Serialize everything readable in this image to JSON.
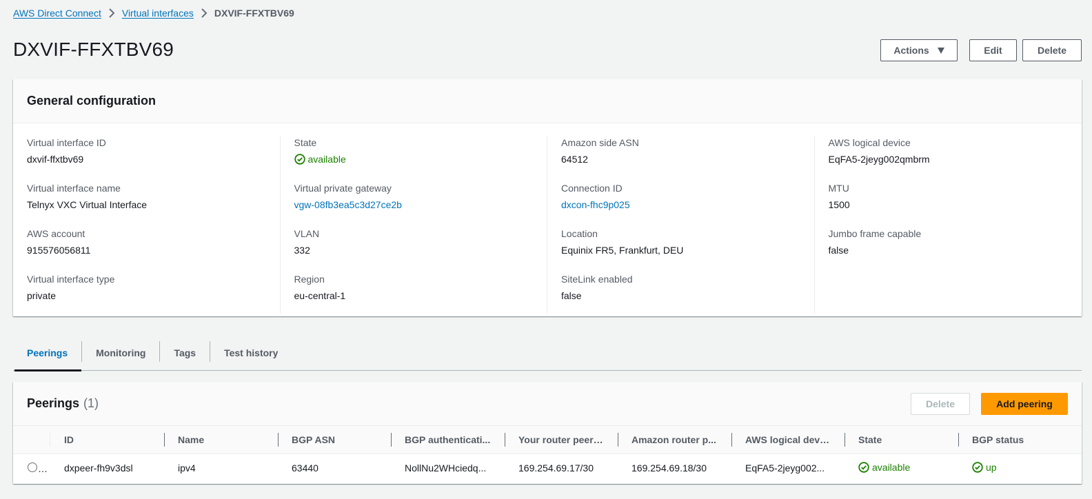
{
  "breadcrumb": {
    "items": [
      {
        "label": "AWS Direct Connect"
      },
      {
        "label": "Virtual interfaces"
      }
    ],
    "current": "DXVIF-FFXTBV69"
  },
  "page": {
    "title": "DXVIF-FFXTBV69"
  },
  "header_actions": {
    "actions_label": "Actions",
    "edit_label": "Edit",
    "delete_label": "Delete"
  },
  "general_configuration": {
    "title": "General configuration",
    "columns": [
      [
        {
          "label": "Virtual interface ID",
          "value": "dxvif-ffxtbv69"
        },
        {
          "label": "Virtual interface name",
          "value": "Telnyx VXC Virtual Interface"
        },
        {
          "label": "AWS account",
          "value": "915576056811"
        },
        {
          "label": "Virtual interface type",
          "value": "private"
        }
      ],
      [
        {
          "label": "State",
          "value": "available"
        },
        {
          "label": "Virtual private gateway",
          "value": "vgw-08fb3ea5c3d27ce2b"
        },
        {
          "label": "VLAN",
          "value": "332"
        },
        {
          "label": "Region",
          "value": "eu-central-1"
        }
      ],
      [
        {
          "label": "Amazon side ASN",
          "value": "64512"
        },
        {
          "label": "Connection ID",
          "value": "dxcon-fhc9p025"
        },
        {
          "label": "Location",
          "value": "Equinix FR5, Frankfurt, DEU"
        },
        {
          "label": "SiteLink enabled",
          "value": "false"
        }
      ],
      [
        {
          "label": "AWS logical device",
          "value": "EqFA5-2jeyg002qmbrm"
        },
        {
          "label": "MTU",
          "value": "1500"
        },
        {
          "label": "Jumbo frame capable",
          "value": "false"
        }
      ]
    ]
  },
  "tabs": [
    {
      "label": "Peerings",
      "active": true
    },
    {
      "label": "Monitoring",
      "active": false
    },
    {
      "label": "Tags",
      "active": false
    },
    {
      "label": "Test history",
      "active": false
    }
  ],
  "peerings": {
    "title": "Peerings",
    "count": "(1)",
    "delete_label": "Delete",
    "add_label": "Add peering",
    "columns": [
      "ID",
      "Name",
      "BGP ASN",
      "BGP authenticati...",
      "Your router peer IP",
      "Amazon router p...",
      "AWS logical device",
      "State",
      "BGP status"
    ],
    "rows": [
      {
        "id": "dxpeer-fh9v3dsl",
        "name": "ipv4",
        "bgp_asn": "63440",
        "bgp_auth": "NollNu2WHciedq...",
        "your_router_ip": "169.254.69.17/30",
        "amazon_router_ip": "169.254.69.18/30",
        "aws_logical_device": "EqFA5-2jeyg002...",
        "state": "available",
        "bgp_status": "up"
      }
    ]
  },
  "colors": {
    "link": "#0073bb",
    "success": "#1d8102",
    "primary_button": "#ff9900",
    "background": "#f2f3f3"
  }
}
